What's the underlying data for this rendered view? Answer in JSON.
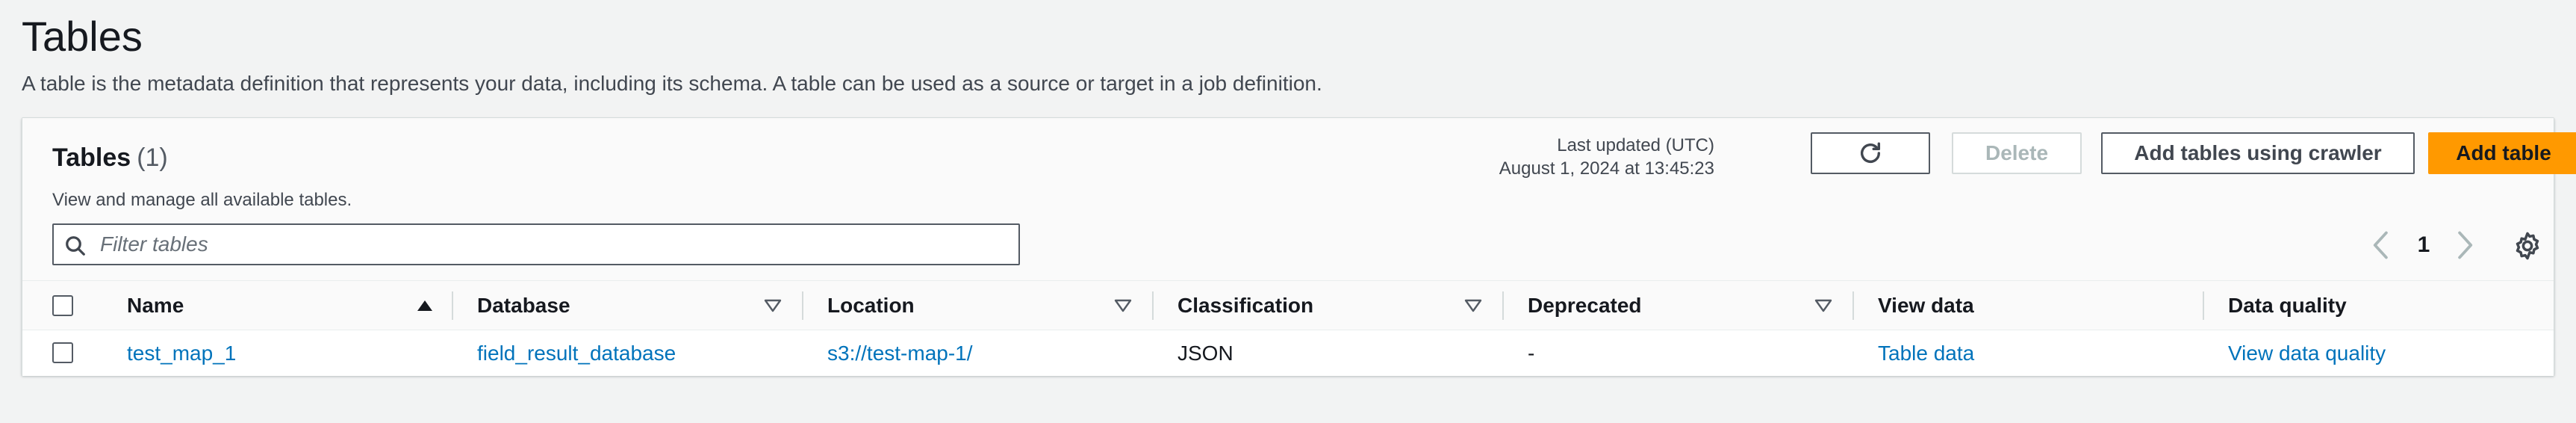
{
  "page": {
    "title": "Tables",
    "description": "A table is the metadata definition that represents your data, including its schema. A table can be used as a source or target in a job definition."
  },
  "card": {
    "title": "Tables",
    "count": "(1)",
    "subtitle": "View and manage all available tables.",
    "last_updated_label": "Last updated (UTC)",
    "last_updated_value": "August 1, 2024 at 13:45:23"
  },
  "toolbar": {
    "delete_label": "Delete",
    "crawler_label": "Add tables using crawler",
    "add_label": "Add table"
  },
  "search": {
    "placeholder": "Filter tables",
    "value": ""
  },
  "pagination": {
    "current_page": "1"
  },
  "table": {
    "columns": [
      "Name",
      "Database",
      "Location",
      "Classification",
      "Deprecated",
      "View data",
      "Data quality"
    ],
    "rows": [
      {
        "name": "test_map_1",
        "database": "field_result_database",
        "location": "s3://test-map-1/",
        "classification": "JSON",
        "deprecated": "-",
        "view_data": "Table data",
        "data_quality": "View data quality"
      }
    ]
  },
  "colors": {
    "primary_button": "#ff9900",
    "link": "#0073bb",
    "background": "#f2f3f3"
  },
  "icons": [
    "refresh-icon",
    "search-icon",
    "chevron-left-icon",
    "chevron-right-icon",
    "settings-icon",
    "sort-ascending-icon",
    "sort-descending-icon"
  ]
}
